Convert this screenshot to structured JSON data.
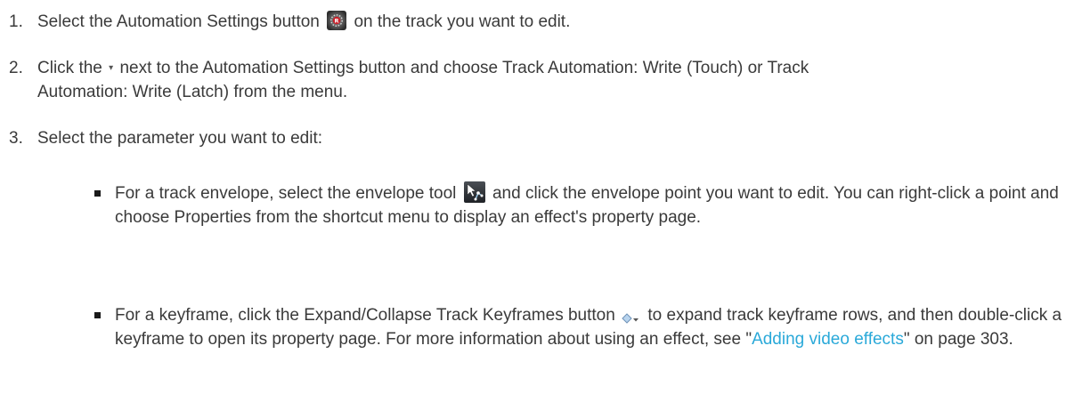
{
  "steps": [
    {
      "num": "1.",
      "before_icon": "Select the Automation Settings button",
      "icon": "automation-settings-icon",
      "after_icon": " on the track you want to edit."
    },
    {
      "num": "2.",
      "part1": "Click the ",
      "icon": "dropdown-caret",
      "caret_glyph": "▾",
      "part2": " next to the Automation Settings button and choose Track Automation: Write (Touch) or Track",
      "line2": "Automation: Write (Latch) from the menu."
    },
    {
      "num": "3.",
      "text": "Select the parameter you want to edit:"
    }
  ],
  "bullets": [
    {
      "before_icon": "For a track envelope, select the envelope tool",
      "icon": "envelope-tool-icon",
      "after_icon": " and click the envelope point you want to edit. You can right-click a point and choose Properties from the shortcut menu to display an effect's property page."
    },
    {
      "before_icon": "For a keyframe, click the Expand/Collapse Track Keyframes button",
      "icon": "keyframes-expand-icon",
      "after_icon": " to expand track keyframe rows, and then double-click a keyframe to open its property page. For more information about using an effect, see \"",
      "link_text": "Adding video effects",
      "after_link": "\" on page 303."
    }
  ],
  "colors": {
    "text": "#3a3a3a",
    "link": "#2aa9d9",
    "bullet": "#1a1a1a"
  }
}
